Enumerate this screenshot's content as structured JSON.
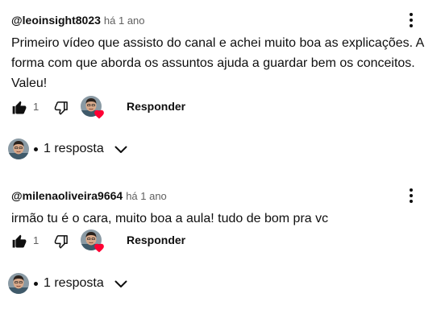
{
  "comments": [
    {
      "author": "@leoinsight8023",
      "time": "há 1 ano",
      "text": "Primeiro vídeo que assisto do canal e achei muito boa as explicações. A forma com que aborda os assuntos ajuda a guardar bem os conceitos. Valeu!",
      "likes": "1",
      "reply_label": "Responder",
      "replies_label": "1 resposta"
    },
    {
      "author": "@milenaoliveira9664",
      "time": "há 1 ano",
      "text": "irmão tu é o cara, muito boa a aula! tudo de bom pra vc",
      "likes": "1",
      "reply_label": "Responder",
      "replies_label": "1 resposta"
    }
  ],
  "icons": {
    "like": "thumb-up-icon",
    "dislike": "thumb-down-icon",
    "heart": "heart-icon",
    "more": "more-vert-icon",
    "expand": "chevron-down-icon"
  },
  "colors": {
    "heart": "#ff0033",
    "muted": "#606060",
    "text": "#0f0f0f"
  }
}
